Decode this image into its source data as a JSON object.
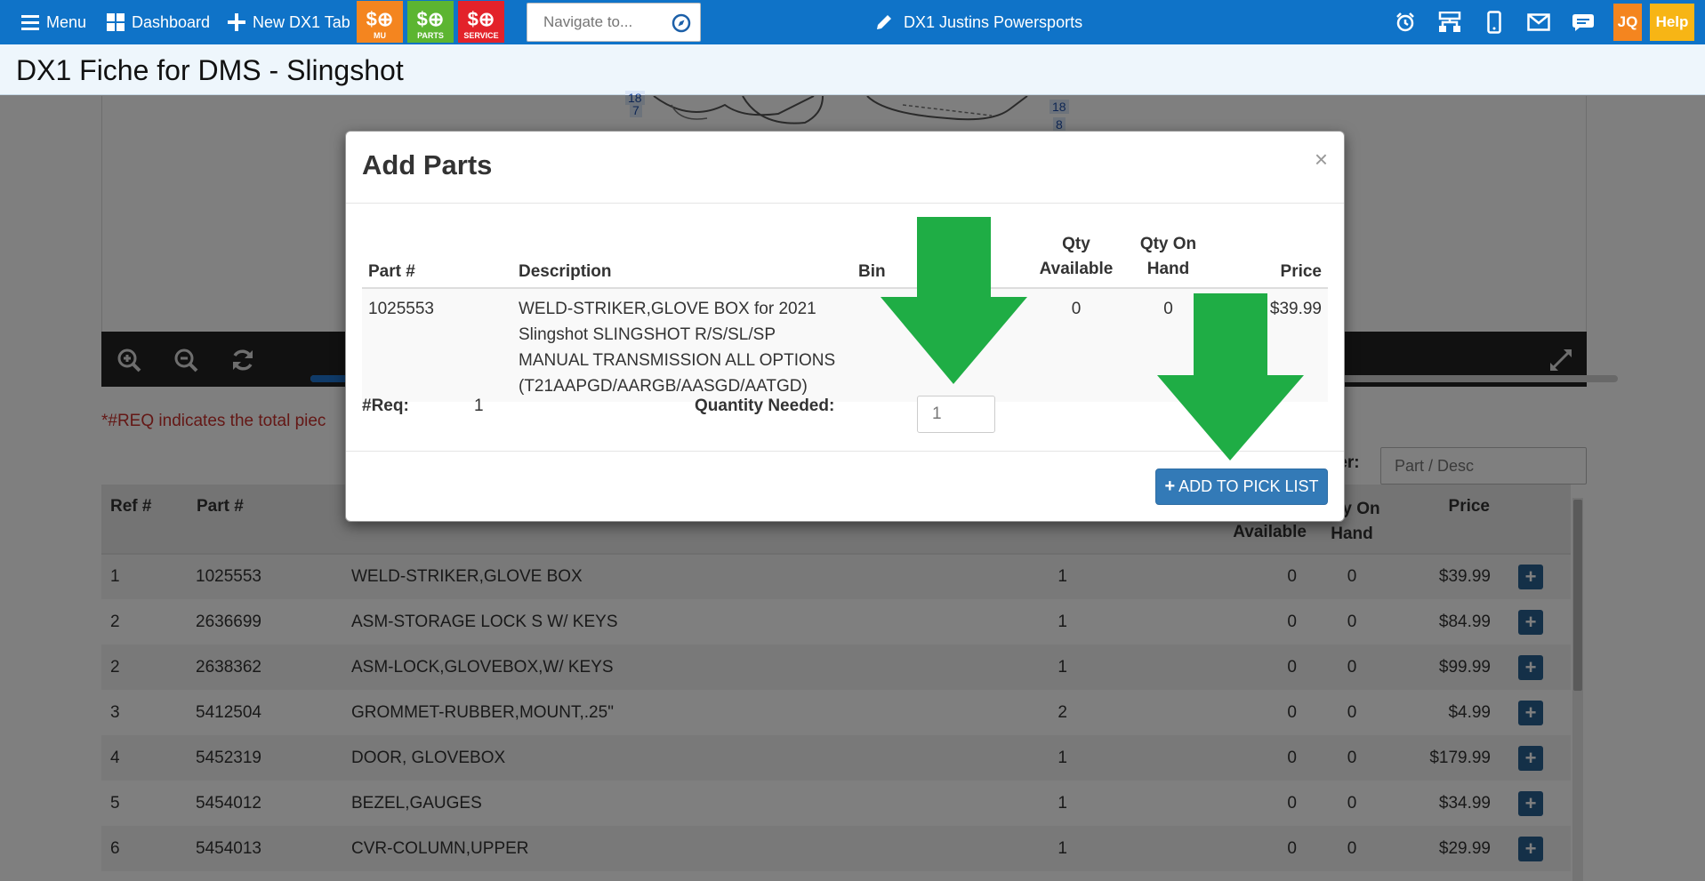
{
  "topbar": {
    "menu_label": "Menu",
    "dashboard_label": "Dashboard",
    "new_tab_label": "New DX1 Tab",
    "tiles": [
      {
        "label": "MU",
        "color": "#f4851f"
      },
      {
        "label": "PARTS",
        "color": "#5cb531"
      },
      {
        "label": "SERVICE",
        "color": "#e3222a"
      }
    ],
    "navigate_placeholder": "Navigate to...",
    "dealer_name": "DX1 Justins Powersports",
    "user_initials": "JQ",
    "help_label": "Help",
    "user_badge_color": "#f4851f",
    "help_badge_color": "#f7b515"
  },
  "page": {
    "title": "DX1 Fiche for DMS - Slingshot"
  },
  "diagram": {
    "callouts": [
      "18",
      "7",
      "18",
      "8"
    ]
  },
  "notice": {
    "req_note": "*#REQ indicates the total piec"
  },
  "filter": {
    "label": "ter:",
    "placeholder": "Part / Desc"
  },
  "parts_table": {
    "headers": [
      "Ref #",
      "Part #",
      "",
      "",
      "Qty Available",
      "Qty On Hand",
      "Price",
      ""
    ],
    "header_lines": {
      "qty_available": [
        "",
        "Available"
      ],
      "qty_on_hand": [
        "Qty On",
        "Hand"
      ]
    },
    "rows": [
      {
        "ref": "1",
        "part": "1025553",
        "desc": "WELD-STRIKER,GLOVE BOX",
        "req": "1",
        "avail": "0",
        "onhand": "0",
        "price": "$39.99"
      },
      {
        "ref": "2",
        "part": "2636699",
        "desc": "ASM-STORAGE LOCK S W/ KEYS",
        "req": "1",
        "avail": "0",
        "onhand": "0",
        "price": "$84.99"
      },
      {
        "ref": "2",
        "part": "2638362",
        "desc": "ASM-LOCK,GLOVEBOX,W/ KEYS",
        "req": "1",
        "avail": "0",
        "onhand": "0",
        "price": "$99.99"
      },
      {
        "ref": "3",
        "part": "5412504",
        "desc": "GROMMET-RUBBER,MOUNT,.25\"",
        "req": "2",
        "avail": "0",
        "onhand": "0",
        "price": "$4.99"
      },
      {
        "ref": "4",
        "part": "5452319",
        "desc": "DOOR, GLOVEBOX",
        "req": "1",
        "avail": "0",
        "onhand": "0",
        "price": "$179.99"
      },
      {
        "ref": "5",
        "part": "5454012",
        "desc": "BEZEL,GAUGES",
        "req": "1",
        "avail": "0",
        "onhand": "0",
        "price": "$34.99"
      },
      {
        "ref": "6",
        "part": "5454013",
        "desc": "CVR-COLUMN,UPPER",
        "req": "1",
        "avail": "0",
        "onhand": "0",
        "price": "$29.99"
      }
    ],
    "add_symbol": "+"
  },
  "modal": {
    "title": "Add Parts",
    "close_symbol": "×",
    "headers": {
      "part": "Part #",
      "description": "Description",
      "bin": "Bin",
      "qty_available_1": "Qty",
      "qty_available_2": "Available",
      "qty_on_hand_1": "Qty On",
      "qty_on_hand_2": "Hand",
      "price": "Price"
    },
    "row": {
      "part": "1025553",
      "description": "WELD-STRIKER,GLOVE BOX for 2021 Slingshot SLINGSHOT R/S/SL/SP MANUAL TRANSMISSION ALL OPTIONS (T21AAPGD/AARGB/AASGD/AATGD)",
      "bin": "",
      "qty_available": "0",
      "qty_on_hand": "0",
      "price": "$39.99"
    },
    "req_label": "#Req:",
    "req_value": "1",
    "qty_label": "Quantity Needed:",
    "qty_value": "1",
    "add_button_label": "ADD TO PICK LIST",
    "add_button_icon": "+",
    "primary_color": "#337ab7"
  },
  "annotations": {
    "arrow_color": "#1fad45"
  }
}
